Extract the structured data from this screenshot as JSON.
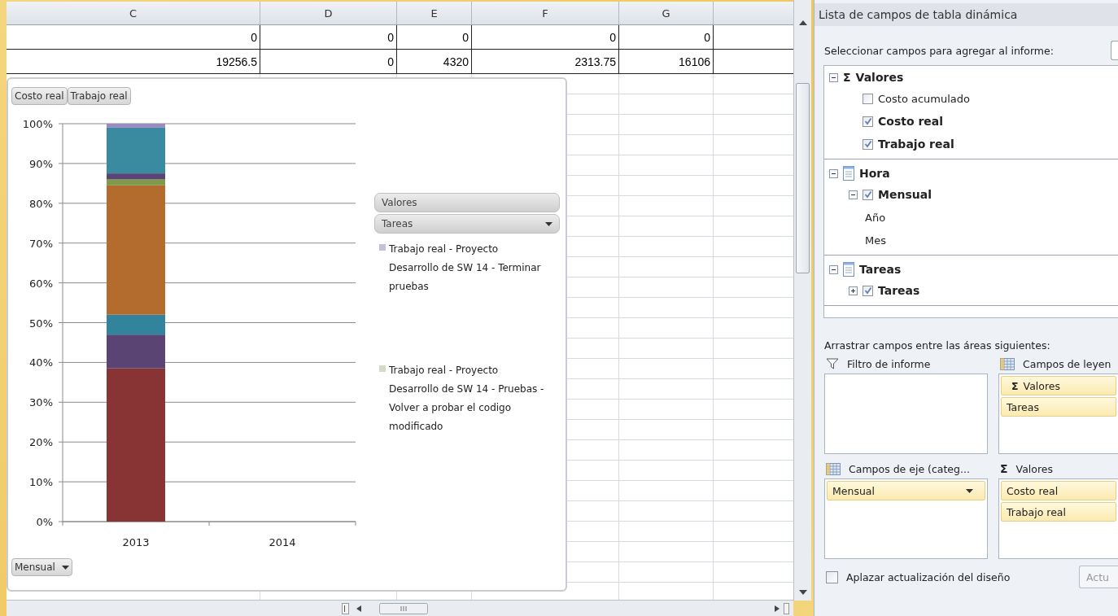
{
  "sheet": {
    "columns": [
      "C",
      "D",
      "E",
      "F",
      "G"
    ],
    "rows": [
      [
        "0",
        "0",
        "0",
        "0",
        "0"
      ],
      [
        "19256.5",
        "0",
        "4320",
        "2313.75",
        "16106"
      ]
    ]
  },
  "chart": {
    "field_buttons": [
      "Costo real",
      "Trabajo real"
    ],
    "legend_header": "Valores",
    "legend_field": "Tareas",
    "legend": [
      {
        "text": "Trabajo real - Proyecto Desarrollo de SW 14 - Terminar pruebas",
        "color": "#c3c1d8"
      },
      {
        "text": "Trabajo real - Proyecto Desarrollo de SW 14 - Pruebas - Volver a probar el codigo modificado",
        "color": "#d3dcc6"
      }
    ],
    "axis_button": "Mensual",
    "chart_data": {
      "type": "bar",
      "stacked": true,
      "grid": true,
      "categories": [
        "2013",
        "2014"
      ],
      "ylim": [
        0,
        100
      ],
      "yticks": [
        {
          "value": 0,
          "label": "0%"
        },
        {
          "value": 10,
          "label": "10%"
        },
        {
          "value": 20,
          "label": "20%"
        },
        {
          "value": 30,
          "label": "30%"
        },
        {
          "value": 40,
          "label": "40%"
        },
        {
          "value": 50,
          "label": "50%"
        },
        {
          "value": 60,
          "label": "60%"
        },
        {
          "value": 70,
          "label": "70%"
        },
        {
          "value": 80,
          "label": "80%"
        },
        {
          "value": 90,
          "label": "90%"
        },
        {
          "value": 100,
          "label": "100%"
        }
      ],
      "series": [
        {
          "color": "#893434",
          "values": [
            38.5,
            null
          ]
        },
        {
          "color": "#5a4474",
          "values": [
            8.5,
            null
          ]
        },
        {
          "color": "#31849b",
          "values": [
            5,
            null
          ]
        },
        {
          "color": "#b36b2e",
          "values": [
            32.5,
            null
          ]
        },
        {
          "color": "#7f9a48",
          "values": [
            1.5,
            null
          ]
        },
        {
          "color": "#5a4474",
          "values": [
            1.5,
            null
          ]
        },
        {
          "color": "#3a8aa0",
          "values": [
            11.5,
            null
          ]
        },
        {
          "color": "#9a8cc0",
          "values": [
            1,
            null
          ]
        }
      ]
    }
  },
  "field_list": {
    "title": "Lista de campos de tabla dinámica",
    "prompt": "Seleccionar campos para agregar al informe:",
    "tree": [
      {
        "label": "Valores",
        "symbol": "Σ",
        "expanded": true,
        "children": [
          {
            "label": "Costo acumulado",
            "checked": false
          },
          {
            "label": "Costo real",
            "checked": true
          },
          {
            "label": "Trabajo real",
            "checked": true
          }
        ]
      },
      {
        "label": "Hora",
        "expanded": true,
        "children": [
          {
            "label": "Mensual",
            "checked": true,
            "expanded": true,
            "children": [
              {
                "label": "Año"
              },
              {
                "label": "Mes"
              }
            ]
          }
        ]
      },
      {
        "label": "Tareas",
        "expanded": true,
        "children": [
          {
            "label": "Tareas",
            "checked": true,
            "expanded": false
          }
        ]
      }
    ],
    "areas_prompt": "Arrastrar campos entre las áreas siguientes:",
    "areas": [
      {
        "title": "Filtro de informe",
        "kind": "filter"
      },
      {
        "title": "Campos de leyen",
        "kind": "grid",
        "items": [
          {
            "label": "Valores",
            "symbol": "Σ"
          },
          {
            "label": "Tareas"
          }
        ]
      },
      {
        "title": "Campos de eje (categ...",
        "kind": "grid",
        "items": [
          {
            "label": "Mensual",
            "dropdown": true
          }
        ]
      },
      {
        "title": "Valores",
        "kind": "sum",
        "symbol": "Σ",
        "items": [
          {
            "label": "Costo real"
          },
          {
            "label": "Trabajo real"
          }
        ]
      }
    ],
    "defer": {
      "label": "Aplazar actualización del diseño",
      "checked": false
    },
    "update_button": "Actu"
  }
}
